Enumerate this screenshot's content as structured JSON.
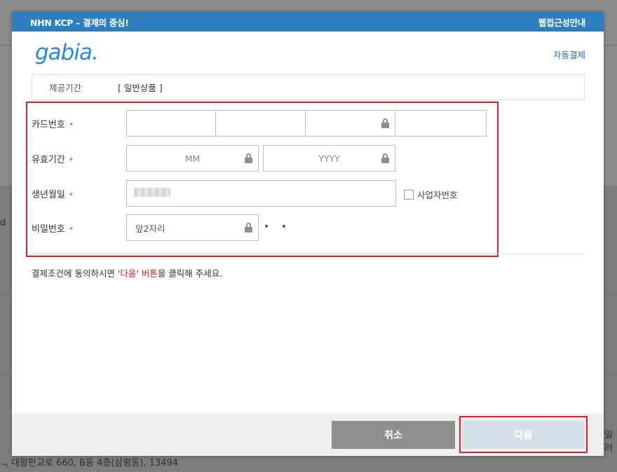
{
  "background": {
    "address_fragment": "ᆨ 대왕판교로 660, B동 4층(삼평동), 13494",
    "left_fragment": "d",
    "right_fragment": "일러"
  },
  "dialog": {
    "title": "NHN KCP – 결제의 중심!",
    "accessibility_link": "웹접근성안내",
    "brand_logo": "gabia.",
    "auto_payment_label": "자동결제",
    "period": {
      "label": "제공기간",
      "value": "[ 일반상품 ]"
    },
    "form": {
      "card_number": {
        "label": "카드번호",
        "required_mark": "*"
      },
      "expiry": {
        "label": "유효기간",
        "required_mark": "*",
        "month_placeholder": "MM",
        "year_placeholder": "YYYY"
      },
      "birth_date": {
        "label": "생년월일",
        "required_mark": "*",
        "business_number_checkbox_label": "사업자번호",
        "business_number_checked": false
      },
      "password": {
        "label": "비밀번호",
        "required_mark": "*",
        "placeholder": "앞2자리",
        "masked_suffix": "• •"
      }
    },
    "notice": {
      "prefix": "결제조건에 동의하시면 ",
      "quote_open": "'",
      "highlight_next": "다음",
      "quote_close": "'",
      "highlight_button": " 버튼",
      "suffix": "을 클릭해 주세요."
    },
    "buttons": {
      "cancel": "취소",
      "next": "다음"
    }
  },
  "colors": {
    "title_bar": "#2e7fc2",
    "accent_red": "#d9202a",
    "logo_blue": "#2f86d3",
    "next_button_disabled": "#d4dfe8",
    "cancel_button": "#8f8f8f"
  },
  "icons": [
    "lock-icon",
    "checkbox-icon"
  ]
}
